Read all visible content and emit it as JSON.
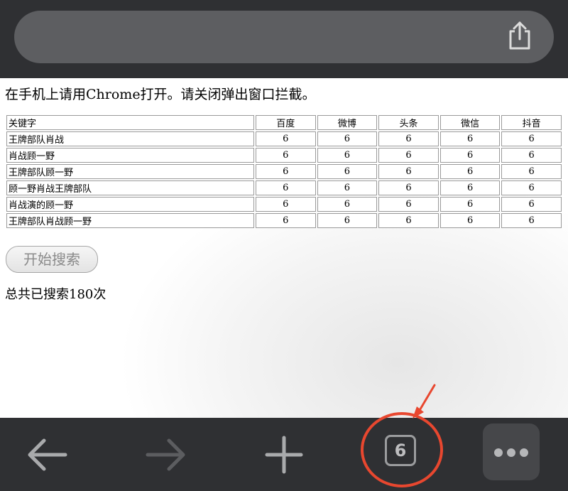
{
  "page": {
    "notice": "在手机上请用Chrome打开。请关闭弹出窗口拦截。",
    "search_button": "开始搜索",
    "total": "总共已搜索180次"
  },
  "table": {
    "headers": [
      "关键字",
      "百度",
      "微博",
      "头条",
      "微信",
      "抖音"
    ],
    "rows": [
      [
        "王牌部队肖战",
        "6",
        "6",
        "6",
        "6",
        "6"
      ],
      [
        "肖战顾一野",
        "6",
        "6",
        "6",
        "6",
        "6"
      ],
      [
        "王牌部队顾一野",
        "6",
        "6",
        "6",
        "6",
        "6"
      ],
      [
        "顾一野肖战王牌部队",
        "6",
        "6",
        "6",
        "6",
        "6"
      ],
      [
        "肖战演的顾一野",
        "6",
        "6",
        "6",
        "6",
        "6"
      ],
      [
        "王牌部队肖战顾一野",
        "6",
        "6",
        "6",
        "6",
        "6"
      ]
    ]
  },
  "toolbar": {
    "tab_count": "6",
    "icons": [
      "back-arrow-icon",
      "forward-arrow-icon",
      "plus-icon",
      "tab-switcher-icon",
      "more-dots-icon"
    ]
  },
  "annotation": {
    "color": "#e8472f"
  },
  "colors": {
    "chrome_bar": "#2f3033",
    "url_bar": "#5d5e61"
  }
}
